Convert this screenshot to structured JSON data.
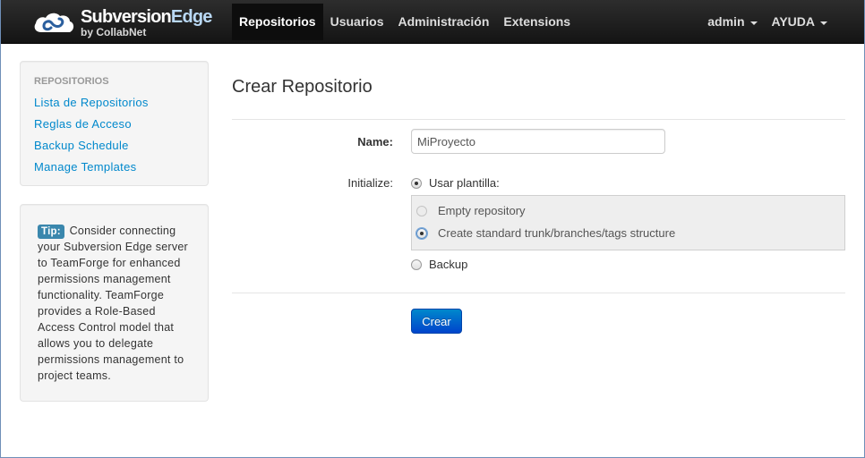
{
  "brand": {
    "name_part1": "Subversion",
    "name_part2": "Edge",
    "sub": "by CollabNet"
  },
  "nav": {
    "items": [
      {
        "label": "Repositorios",
        "active": true
      },
      {
        "label": "Usuarios"
      },
      {
        "label": "Administración"
      },
      {
        "label": "Extensions"
      }
    ],
    "user_menu": "admin",
    "help_menu": "AYUDA"
  },
  "sidebar": {
    "header": "REPOSITORIOS",
    "links": [
      "Lista de Repositorios",
      "Reglas de Acceso",
      "Backup Schedule",
      "Manage Templates"
    ],
    "tip_label": "Tip:",
    "tip_text": "Consider connecting your Subversion Edge server to TeamForge for enhanced permissions management functionality. TeamForge provides a Role-Based Access Control model that allows you to delegate permissions management to project teams."
  },
  "form": {
    "title": "Crear Repositorio",
    "name_label": "Name:",
    "name_value": "MiProyecto",
    "initialize_label": "Initialize:",
    "option_template": "Usar plantilla:",
    "option_empty": "Empty repository",
    "option_standard": "Create standard trunk/branches/tags structure",
    "option_backup": "Backup",
    "submit_label": "Crear"
  },
  "colors": {
    "link": "#0088cc",
    "primary_button": "#0055cc",
    "navbar": "#1b1b1b",
    "tip_badge": "#3a87ad"
  }
}
